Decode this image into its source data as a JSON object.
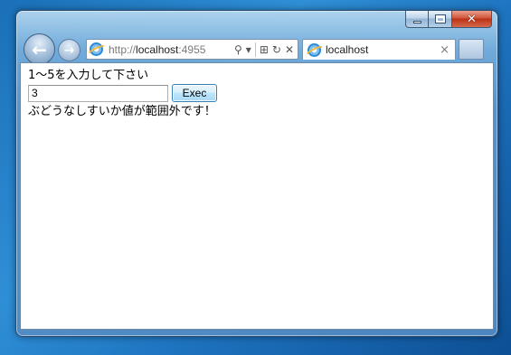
{
  "window": {
    "minimize_glyph": "",
    "maximize_glyph": "",
    "close_glyph": "✕"
  },
  "toolbar": {
    "back_glyph": "←",
    "forward_glyph": "→",
    "address_prefix": "http://",
    "address_host": "localhost",
    "address_port": ":4955",
    "search_glyph": "⚲",
    "dropdown_glyph": "▾",
    "compat_glyph": "⊞",
    "refresh_glyph": "↻",
    "stop_glyph": "✕"
  },
  "tab": {
    "label": "localhost",
    "close_glyph": "×"
  },
  "page": {
    "prompt": "1～5を入力して下さい",
    "input_value": "3",
    "exec_label": "Exec",
    "message": "ぶどうなしすいか値が範囲外です！"
  },
  "colors": {
    "desktop": "#1e74c0",
    "frame": "#6f98c6",
    "close_button": "#c7402a"
  }
}
